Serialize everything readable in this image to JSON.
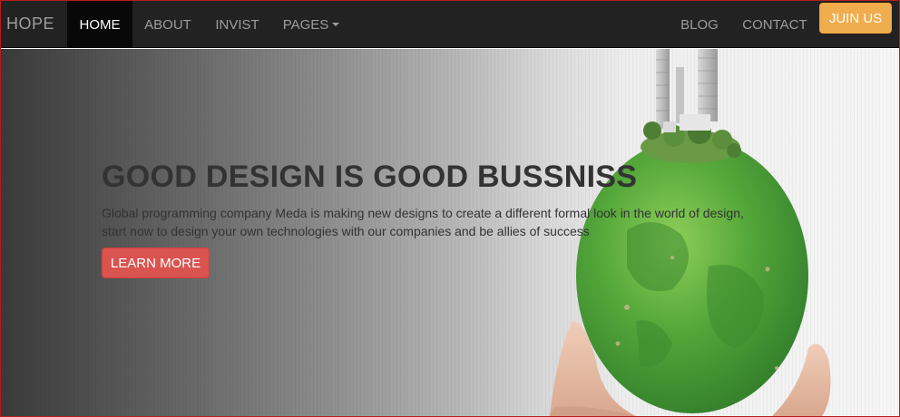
{
  "navbar": {
    "brand": "HOPE",
    "items": [
      {
        "label": "HOME",
        "active": true
      },
      {
        "label": "ABOUT",
        "active": false
      },
      {
        "label": "INVIST",
        "active": false
      },
      {
        "label": "PAGES",
        "active": false,
        "has_dropdown": true
      },
      {
        "label": "BLOG",
        "active": false
      },
      {
        "label": "CONTACT",
        "active": false
      }
    ],
    "join_button": "JUIN US"
  },
  "hero": {
    "title": "GOOD DESIGN IS GOOD BUSSNISS",
    "text": "Global programming company Meda is making new designs to create a different formal look in the world of design, start now to design your own technologies with our companies and be allies of success",
    "button": "LEARN MORE",
    "image": "hands-holding-green-globe-with-city"
  },
  "colors": {
    "navbar_bg": "#222222",
    "nav_active_bg": "#080808",
    "join_button": "#f0ad4e",
    "learn_button": "#d9534f"
  }
}
